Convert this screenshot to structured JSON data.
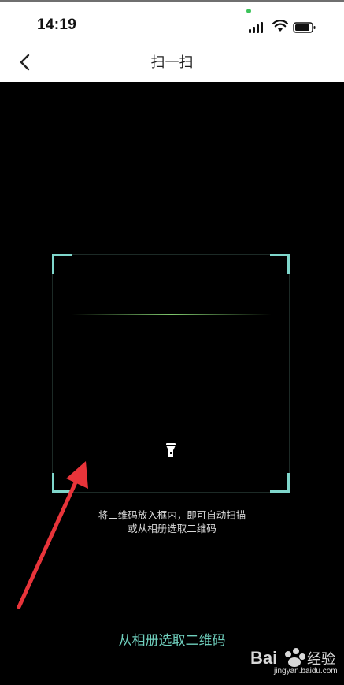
{
  "status_bar": {
    "time": "14:19"
  },
  "nav": {
    "title": "扫一扫",
    "back_icon": "chevron-left-icon"
  },
  "scanner": {
    "hint_line1": "将二维码放入框内，即可自动扫描",
    "hint_line2": "或从相册选取二维码",
    "album_link": "从相册选取二维码",
    "accent_color": "#7fd6cb",
    "scan_line_color": "#8cdc78",
    "flashlight_icon": "flashlight-icon"
  },
  "overlay": {
    "annotation": "red-arrow",
    "color": "#e8343a"
  },
  "watermark": {
    "brand": "Bai经验",
    "url": "jingyan.baidu.com"
  }
}
